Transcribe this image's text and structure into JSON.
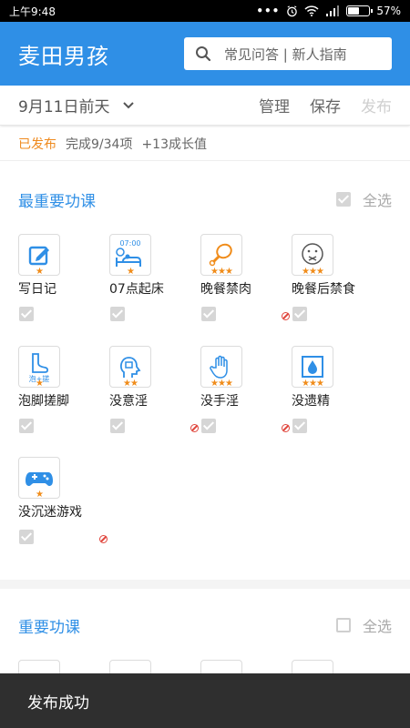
{
  "status_bar": {
    "time": "上午9:48",
    "battery": "57%",
    "battery_level": 0.57
  },
  "header": {
    "title": "麦田男孩",
    "search_placeholder": "常见问答 | 新人指南"
  },
  "toolbar": {
    "date": "9月11日前天",
    "manage": "管理",
    "save": "保存",
    "publish": "发布"
  },
  "summary": {
    "status": "已发布",
    "progress": "完成9/34项",
    "growth": "+13成长值"
  },
  "sections": [
    {
      "title": "最重要功课",
      "select_all": "全选",
      "all_checked": true,
      "items": [
        {
          "label": "写日记",
          "icon": "pencil-icon",
          "stars": "★",
          "forbidden": false,
          "checked": true
        },
        {
          "label": "07点起床",
          "icon": "alarm-bed-icon",
          "icon_text": "07:00",
          "stars": "★",
          "forbidden": false,
          "checked": true
        },
        {
          "label": "晚餐禁肉",
          "icon": "drumstick-icon",
          "stars": "★★★",
          "forbidden": true,
          "checked": true
        },
        {
          "label": "晚餐后禁食",
          "icon": "sealed-mouth-face-icon",
          "stars": "★★★",
          "forbidden": false,
          "checked": true
        },
        {
          "label": "泡脚搓脚",
          "icon": "foot-icon",
          "icon_text": "泡+搓",
          "stars": "★",
          "forbidden": false,
          "checked": true
        },
        {
          "label": "没意淫",
          "icon": "head-profile-icon",
          "stars": "★★",
          "forbidden": true,
          "checked": true
        },
        {
          "label": "没手淫",
          "icon": "hand-icon",
          "stars": "★★★",
          "forbidden": true,
          "checked": true
        },
        {
          "label": "没遗精",
          "icon": "water-drop-icon",
          "stars": "★★★",
          "forbidden": false,
          "checked": true
        },
        {
          "label": "没沉迷游戏",
          "icon": "gamepad-icon",
          "stars": "★",
          "forbidden": true,
          "checked": true
        }
      ]
    },
    {
      "title": "重要功课",
      "select_all": "全选",
      "all_checked": false
    }
  ],
  "toast": "发布成功",
  "colors": {
    "primary": "#2f8fe6",
    "accent": "#ef8a1e",
    "star": "#f08c1a",
    "forbidden": "#e0463d"
  }
}
